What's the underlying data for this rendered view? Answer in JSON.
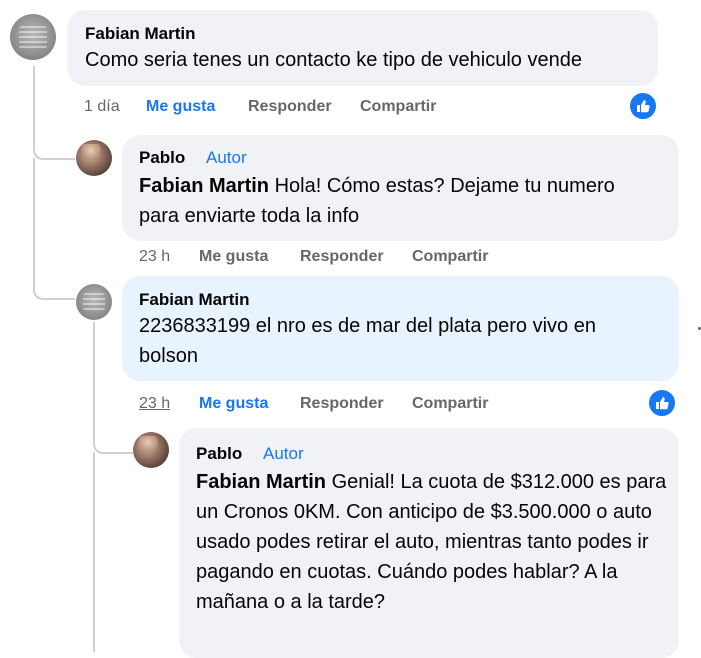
{
  "comments": [
    {
      "author": "Fabian Martin",
      "badge": "",
      "mention": "",
      "text": "Como seria tenes un contacto ke tipo de vehiculo vende",
      "time": "1 día",
      "actions": {
        "like": "Me gusta",
        "reply": "Responder",
        "share": "Compartir"
      },
      "liked": true,
      "reaction_icon": "thumbs-up-icon"
    },
    {
      "author": "Pablo",
      "badge": "Autor",
      "mention": "Fabian Martin",
      "text": " Hola! Cómo estas? Dejame tu numero para enviarte toda la info",
      "time": "23 h",
      "actions": {
        "like": "Me gusta",
        "reply": "Responder",
        "share": "Compartir"
      },
      "liked": false
    },
    {
      "author": "Fabian Martin",
      "badge": "",
      "mention": "",
      "text": "2236833199 el nro es de mar del plata pero vivo en bolson",
      "time": "23 h",
      "actions": {
        "like": "Me gusta",
        "reply": "Responder",
        "share": "Compartir"
      },
      "liked": true,
      "reaction_icon": "thumbs-up-icon"
    },
    {
      "author": "Pablo",
      "badge": "Autor",
      "mention": "Fabian Martin",
      "text": " Genial! La cuota de $312.000 es para un Cronos 0KM. Con anticipo de $3.500.000 o auto usado podes retirar el auto, mientras tanto podes ir pagando en cuotas. Cuándo podes hablar? A la mañana o a la tarde?"
    }
  ],
  "colors": {
    "accent": "#1877f2",
    "bubble": "#f0f2f5",
    "bubble_highlight": "#e7f3ff",
    "meta": "#65676b"
  }
}
